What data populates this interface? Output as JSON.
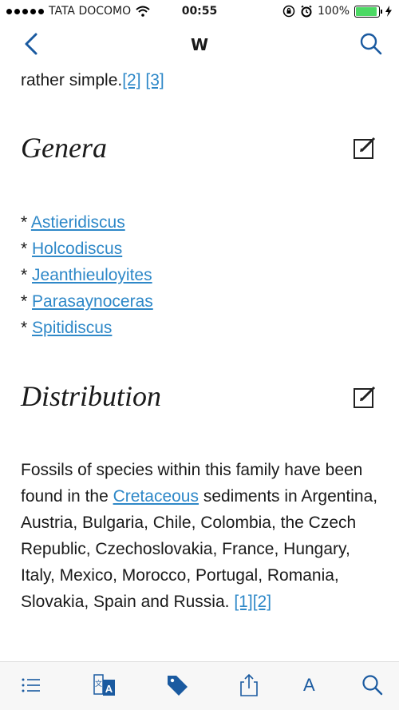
{
  "status": {
    "carrier": "TATA DOCOMO",
    "time": "00:55",
    "battery": "100%"
  },
  "nav": {
    "title": "W"
  },
  "article": {
    "intro_text": "rather simple.",
    "intro_refs": [
      "[2]",
      "[3]"
    ],
    "sections": [
      {
        "heading": "Genera",
        "items": [
          "Astieridiscus",
          "Holcodiscus",
          "Jeanthieuloyites",
          "Parasaynoceras",
          "Spitidiscus"
        ]
      },
      {
        "heading": "Distribution",
        "text_before": "Fossils of species within this family have been found in the ",
        "link": "Cretaceous",
        "text_after": " sediments in Argentina, Austria, Bulgaria, Chile, Colombia, the Czech Republic, Czechoslovakia, France, Hungary, Italy, Mexico, Morocco, Portugal, Romania, Slovakia, Spain and Russia. ",
        "refs": [
          "[1]",
          "[2]"
        ]
      }
    ]
  },
  "toolbar": {
    "font_label": "A"
  },
  "colors": {
    "accent": "#1a5aa0",
    "link": "#2e88c8",
    "battery": "#4cd964"
  }
}
